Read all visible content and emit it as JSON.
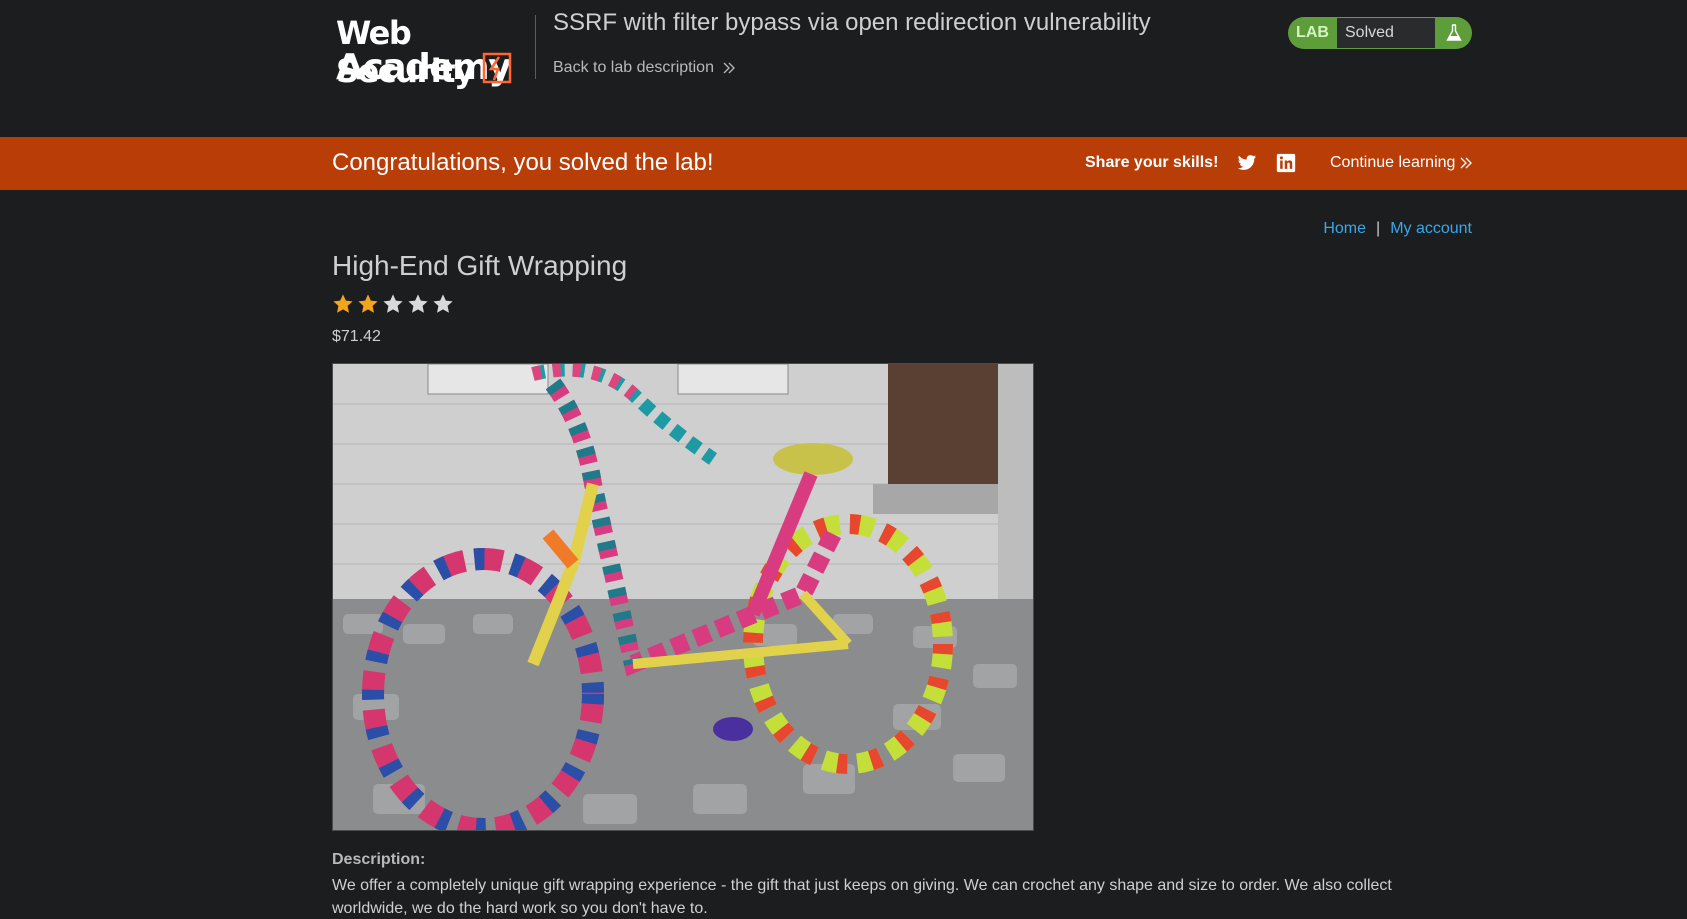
{
  "logo": {
    "line1": "Web Security",
    "line2": "Academy"
  },
  "lab": {
    "title": "SSRF with filter bypass via open redirection vulnerability",
    "back_link": "Back to lab description",
    "status_badge": "LAB",
    "status": "Solved",
    "accent_color": "#5d9e3a"
  },
  "banner": {
    "message": "Congratulations, you solved the lab!",
    "share_label": "Share your skills!",
    "continue_label": "Continue learning",
    "color": "#b93d07"
  },
  "nav": {
    "home": "Home",
    "separator": "|",
    "account": "My account"
  },
  "product": {
    "title": "High-End Gift Wrapping",
    "rating": 2,
    "rating_max": 5,
    "price": "$71.42",
    "image_alt": "crochet-wrapped bicycle",
    "description_label": "Description:",
    "description": "We offer a completely unique gift wrapping experience - the gift that just keeps on giving. We can crochet any shape and size to order. We also collect worldwide, we do the hard work so you don't have to."
  },
  "icons": {
    "back": "chevron-double-right-icon",
    "flask": "flask-icon",
    "twitter": "twitter-icon",
    "linkedin": "linkedin-icon",
    "star": "star-icon"
  }
}
